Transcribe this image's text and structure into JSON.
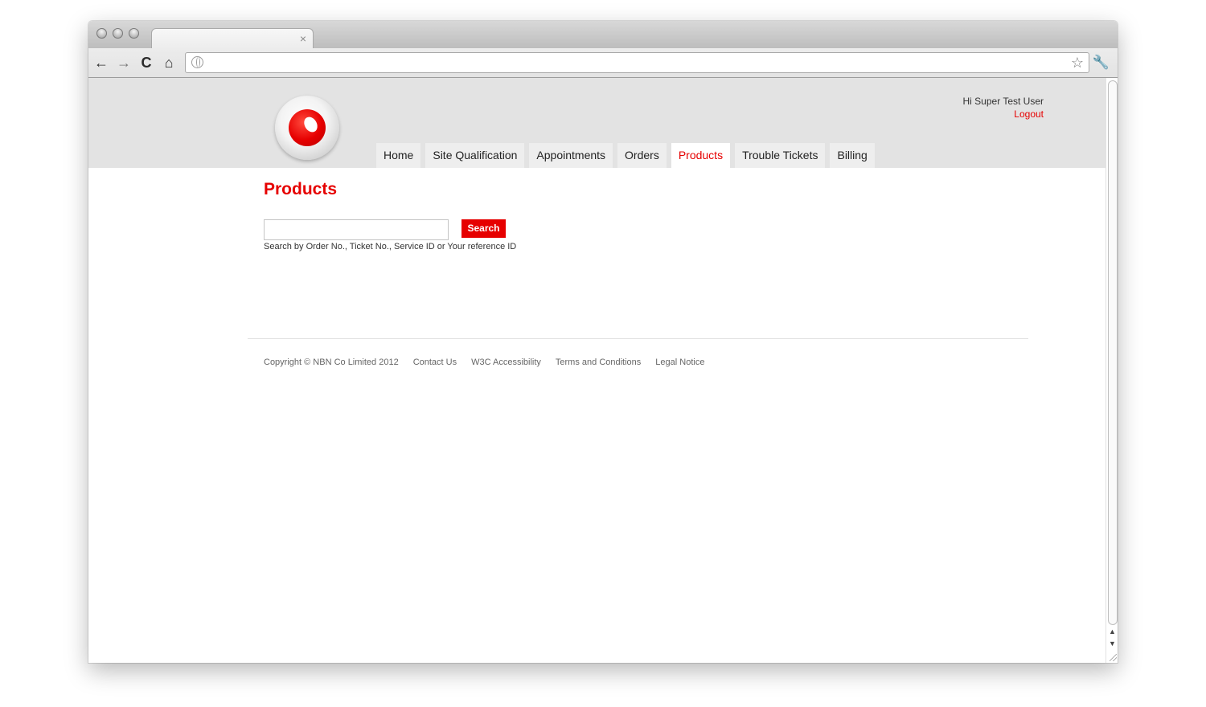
{
  "browser": {
    "tab_close_glyph": "×",
    "nav": {
      "back_icon": "←",
      "forward_icon": "→",
      "reload_icon": "C",
      "home_icon": "⌂"
    },
    "star_glyph": "☆",
    "wrench_glyph": "🔧",
    "scroll_up": "▲",
    "scroll_down": "▼"
  },
  "header": {
    "greeting": "Hi Super Test User",
    "logout": "Logout"
  },
  "nav": {
    "items": [
      {
        "label": "Home"
      },
      {
        "label": "Site Qualification"
      },
      {
        "label": "Appointments"
      },
      {
        "label": "Orders"
      },
      {
        "label": "Products"
      },
      {
        "label": "Trouble Tickets"
      },
      {
        "label": "Billing"
      }
    ],
    "active": "Products"
  },
  "main": {
    "title": "Products",
    "search": {
      "value": "",
      "placeholder": "",
      "button": "Search",
      "help": "Search by Order No., Ticket No., Service ID or Your reference ID"
    }
  },
  "footer": {
    "copyright": "Copyright © NBN Co Limited 2012",
    "links": [
      "Contact Us",
      "W3C Accessibility",
      "Terms and Conditions",
      "Legal Notice"
    ]
  },
  "colors": {
    "brand": "#e60000",
    "header_bg": "#e3e3e3",
    "tab_bg": "#eeeeee"
  }
}
